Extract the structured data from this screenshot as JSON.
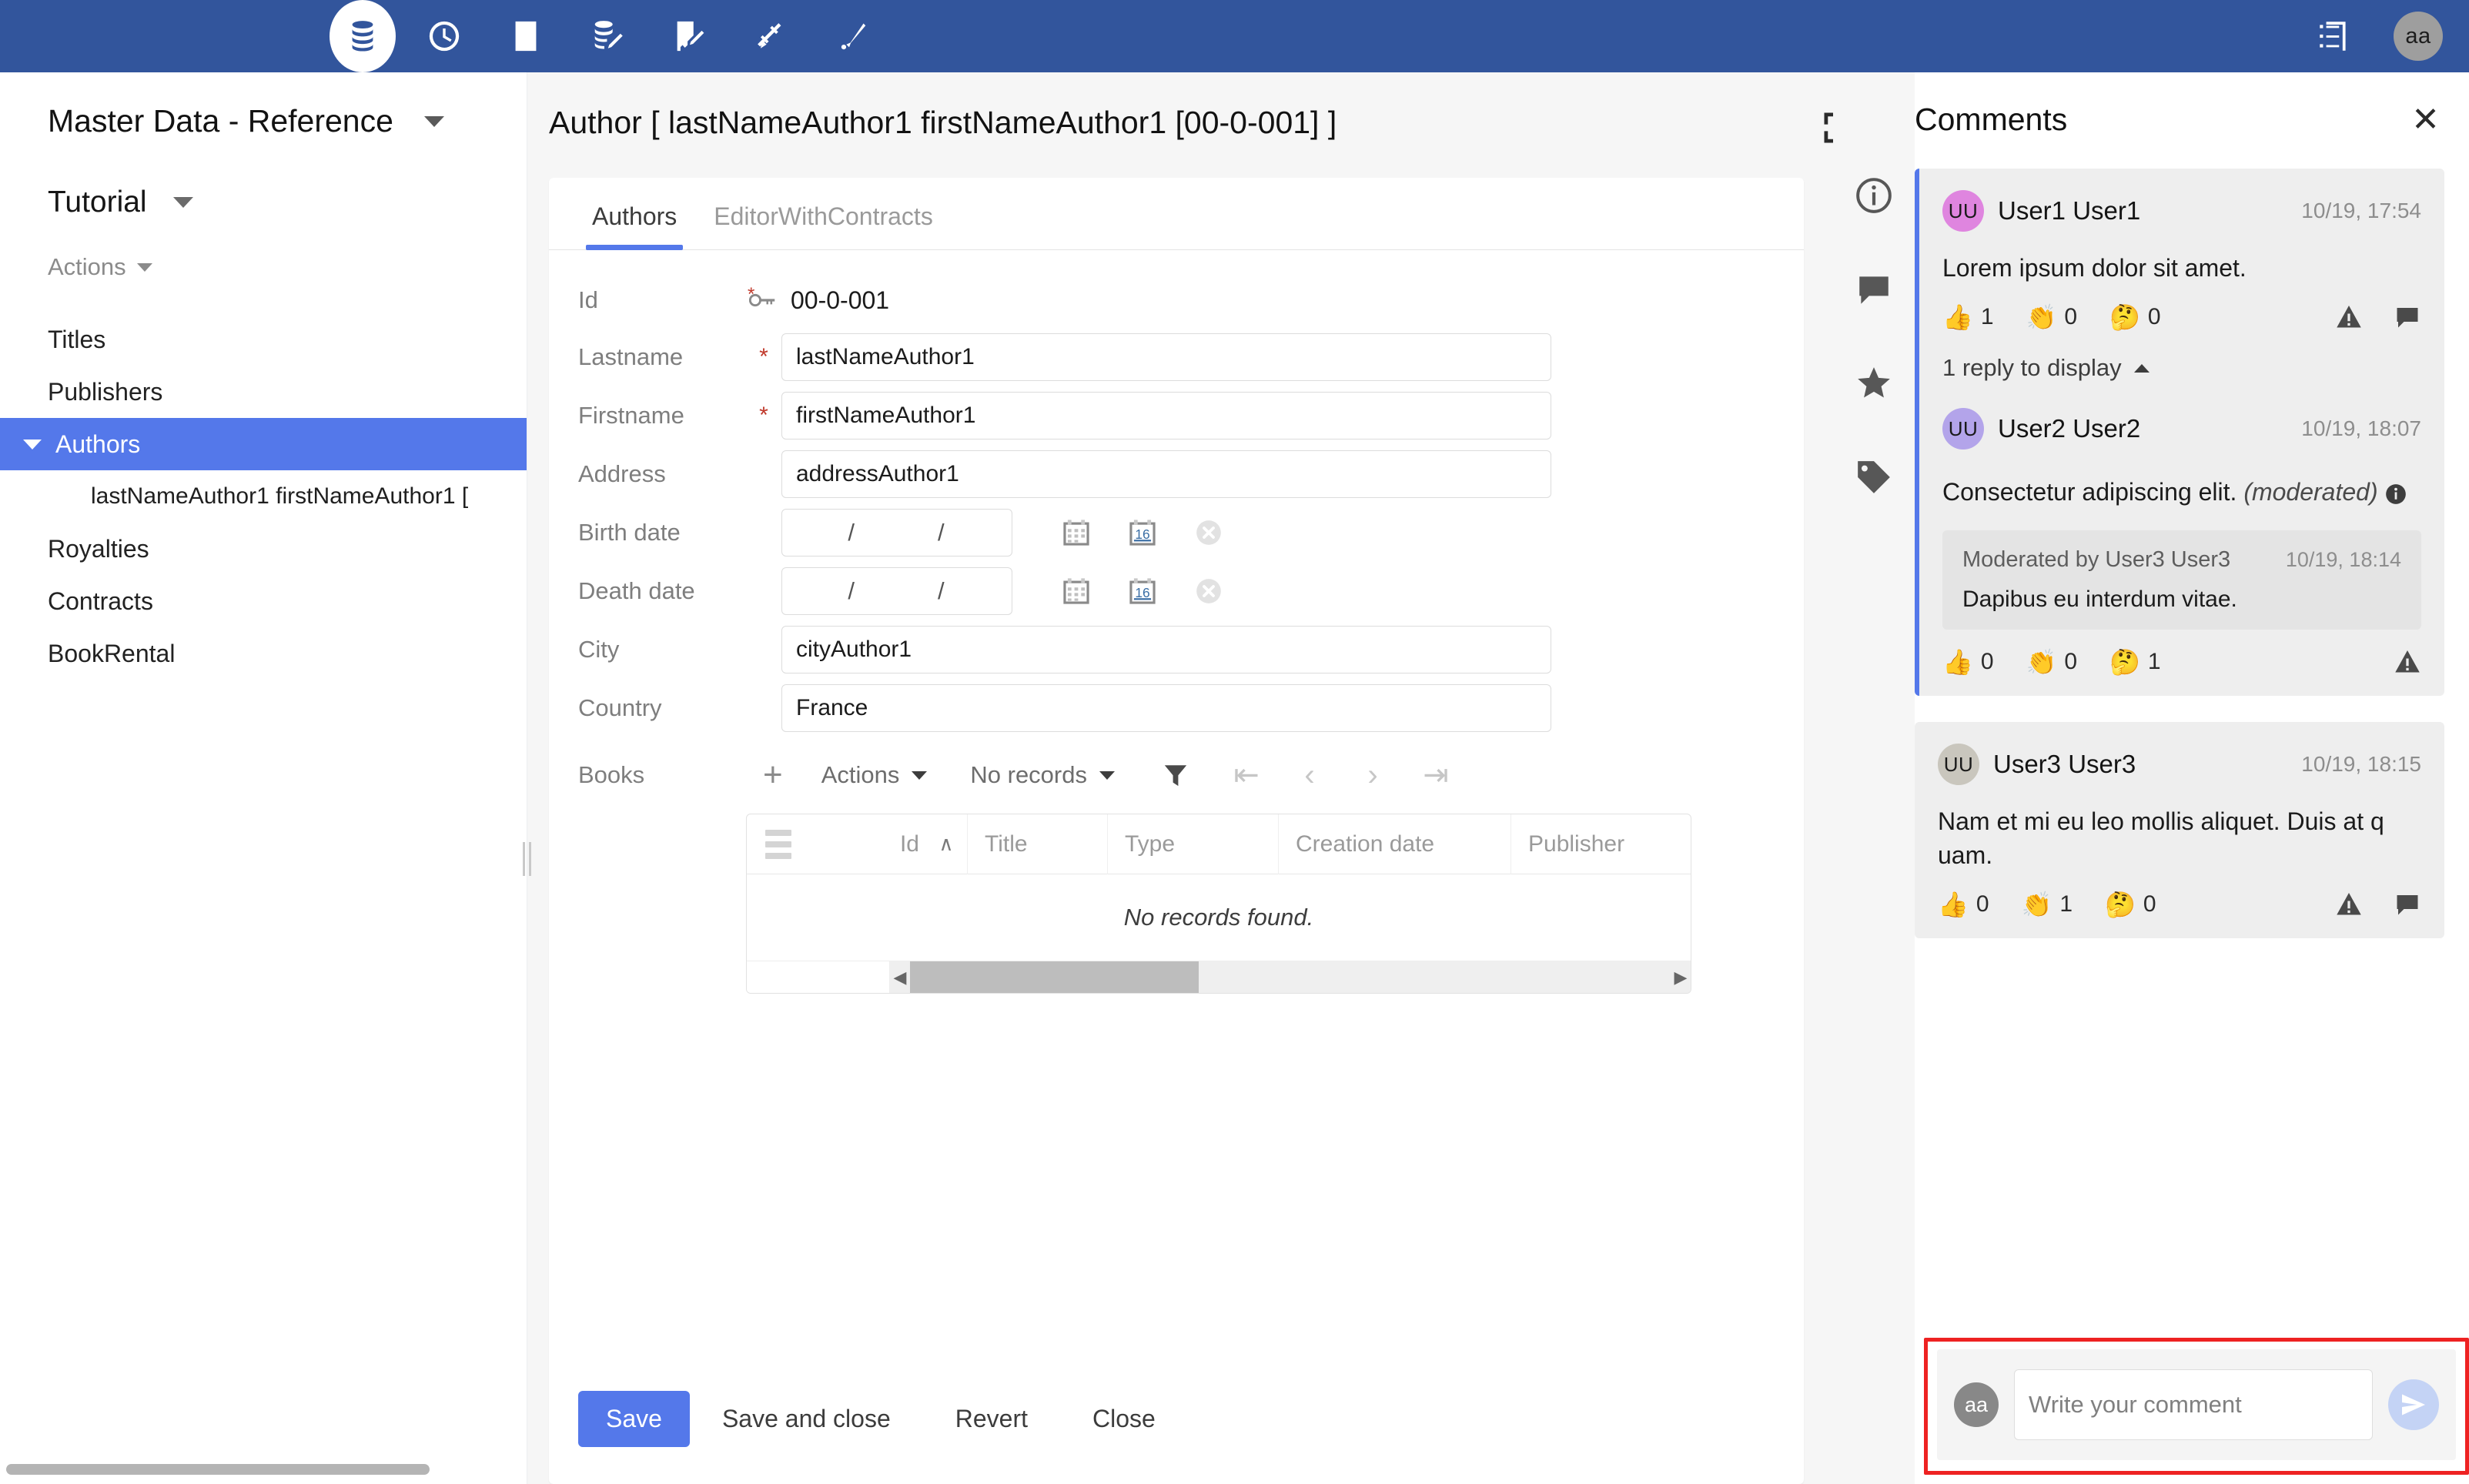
{
  "topbar": {
    "bg_color": "#32559c",
    "icons": [
      {
        "name": "database-icon",
        "active": true
      },
      {
        "name": "clock-icon",
        "active": false
      },
      {
        "name": "checklist-icon",
        "active": false
      },
      {
        "name": "database-edit-icon",
        "active": false
      },
      {
        "name": "checklist-edit-icon",
        "active": false
      },
      {
        "name": "plug-icon",
        "active": false
      },
      {
        "name": "wrench-icon",
        "active": false
      }
    ],
    "right_icon": "list-view-icon",
    "avatar": "aa"
  },
  "sidebar": {
    "title": "Master Data - Reference",
    "subtitle": "Tutorial",
    "actions_label": "Actions",
    "items": [
      {
        "label": "Titles",
        "selected": false,
        "child": false
      },
      {
        "label": "Publishers",
        "selected": false,
        "child": false
      },
      {
        "label": "Authors",
        "selected": true,
        "child": false
      },
      {
        "label": "lastNameAuthor1 firstNameAuthor1 [",
        "selected": false,
        "child": true
      },
      {
        "label": "Royalties",
        "selected": false,
        "child": false
      },
      {
        "label": "Contracts",
        "selected": false,
        "child": false
      },
      {
        "label": "BookRental",
        "selected": false,
        "child": false
      }
    ],
    "selected_color": "#5478ea"
  },
  "main": {
    "title": "Author [ lastNameAuthor1 firstNameAuthor1 [00-0-001] ]",
    "tabs": [
      {
        "label": "Authors",
        "active": true
      },
      {
        "label": "EditorWithContracts",
        "active": false
      }
    ],
    "form": {
      "id": {
        "label": "Id",
        "value": "00-0-001"
      },
      "lastname": {
        "label": "Lastname",
        "value": "lastNameAuthor1",
        "required": "*"
      },
      "firstname": {
        "label": "Firstname",
        "value": "firstNameAuthor1",
        "required": "*"
      },
      "address": {
        "label": "Address",
        "value": "addressAuthor1"
      },
      "birth_date": {
        "label": "Birth date",
        "value": "/          /"
      },
      "death_date": {
        "label": "Death date",
        "value": "/          /"
      },
      "city": {
        "label": "City",
        "value": "cityAuthor1"
      },
      "country": {
        "label": "Country",
        "value": "France"
      }
    },
    "books": {
      "label": "Books",
      "add_label": "+",
      "actions_label": "Actions",
      "records_label": "No records",
      "columns": [
        "Id",
        "Title",
        "Type",
        "Creation date",
        "Publisher"
      ],
      "sort_indicator": "∧",
      "empty_message": "No records found."
    },
    "buttons": {
      "save": "Save",
      "save_and_close": "Save and close",
      "revert": "Revert",
      "close": "Close"
    }
  },
  "rail": {
    "icons": [
      "info-icon",
      "comment-icon",
      "star-icon",
      "tag-icon"
    ]
  },
  "comments": {
    "title": "Comments",
    "expand_icon": "expand-icon",
    "close_icon": "close-icon",
    "items": [
      {
        "avatar": "UU",
        "avatar_color": "#df85df",
        "author": "User1 User1",
        "time": "10/19, 17:54",
        "text": "Lorem ipsum dolor sit amet.",
        "threaded": true,
        "reactions": [
          {
            "emoji": "👍",
            "name": "thumbs-up-reaction",
            "count": "1"
          },
          {
            "emoji": "👏",
            "name": "clap-reaction",
            "count": "0"
          },
          {
            "emoji": "🤔",
            "name": "thinking-reaction",
            "count": "0"
          }
        ],
        "actions": [
          "warning-icon",
          "reply-icon"
        ],
        "replies_toggle": "1 reply to display",
        "nested": {
          "avatar": "UU",
          "avatar_color": "#b3a4ea",
          "author": "User2 User2",
          "time": "10/19, 18:07",
          "text": "Consectetur adipiscing elit.",
          "moderated_tag": "(moderated)",
          "moderation": {
            "by": "Moderated by User3 User3",
            "time": "10/19, 18:14",
            "text": "Dapibus eu interdum vitae."
          },
          "reactions": [
            {
              "emoji": "👍",
              "name": "thumbs-up-reaction",
              "count": "0"
            },
            {
              "emoji": "👏",
              "name": "clap-reaction",
              "count": "0"
            },
            {
              "emoji": "🤔",
              "name": "thinking-reaction",
              "count": "1"
            }
          ],
          "actions": [
            "warning-icon"
          ]
        }
      },
      {
        "avatar": "UU",
        "avatar_color": "#c9c6bd",
        "author": "User3 User3",
        "time": "10/19, 18:15",
        "text": "Nam et mi eu leo mollis aliquet. Duis at q uam.",
        "threaded": false,
        "reactions": [
          {
            "emoji": "👍",
            "name": "thumbs-up-reaction",
            "count": "0"
          },
          {
            "emoji": "👏",
            "name": "clap-reaction",
            "count": "1"
          },
          {
            "emoji": "🤔",
            "name": "thinking-reaction",
            "count": "0"
          }
        ],
        "actions": [
          "warning-icon",
          "reply-icon"
        ]
      }
    ],
    "composer": {
      "avatar": "aa",
      "placeholder": "Write your comment",
      "value": "",
      "send_icon": "send-icon",
      "highlight_color": "#ee2222"
    }
  }
}
